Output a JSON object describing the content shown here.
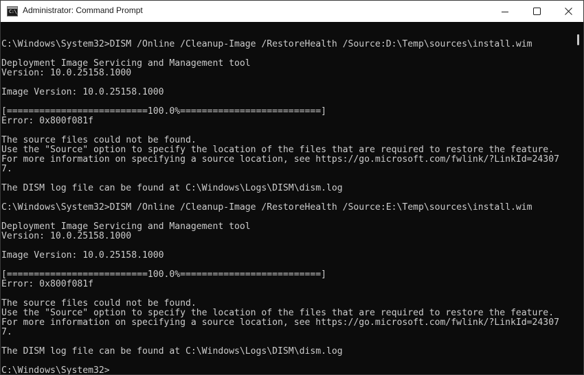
{
  "window": {
    "title": "Administrator: Command Prompt",
    "app_icon": "command-prompt-icon",
    "app_icon_glyph": "C:\\_",
    "controls": [
      "minimize-icon",
      "maximize-icon",
      "close-icon"
    ]
  },
  "console": {
    "lines": [
      "",
      "C:\\Windows\\System32>DISM /Online /Cleanup-Image /RestoreHealth /Source:D:\\Temp\\sources\\install.wim",
      "",
      "Deployment Image Servicing and Management tool",
      "Version: 10.0.25158.1000",
      "",
      "Image Version: 10.0.25158.1000",
      "",
      "[==========================100.0%==========================]",
      "Error: 0x800f081f",
      "",
      "The source files could not be found.",
      "Use the \"Source\" option to specify the location of the files that are required to restore the feature.",
      "For more information on specifying a source location, see https://go.microsoft.com/fwlink/?LinkId=24307",
      "7.",
      "",
      "The DISM log file can be found at C:\\Windows\\Logs\\DISM\\dism.log",
      "",
      "C:\\Windows\\System32>DISM /Online /Cleanup-Image /RestoreHealth /Source:E:\\Temp\\sources\\install.wim",
      "",
      "Deployment Image Servicing and Management tool",
      "Version: 10.0.25158.1000",
      "",
      "Image Version: 10.0.25158.1000",
      "",
      "[==========================100.0%==========================]",
      "Error: 0x800f081f",
      "",
      "The source files could not be found.",
      "Use the \"Source\" option to specify the location of the files that are required to restore the feature.",
      "For more information on specifying a source location, see https://go.microsoft.com/fwlink/?LinkId=24307",
      "7.",
      "",
      "The DISM log file can be found at C:\\Windows\\Logs\\DISM\\dism.log",
      "",
      "C:\\Windows\\System32>"
    ]
  },
  "colors": {
    "console_bg": "#0c0c0c",
    "console_fg": "#cccccc",
    "titlebar_bg": "#ffffff"
  }
}
